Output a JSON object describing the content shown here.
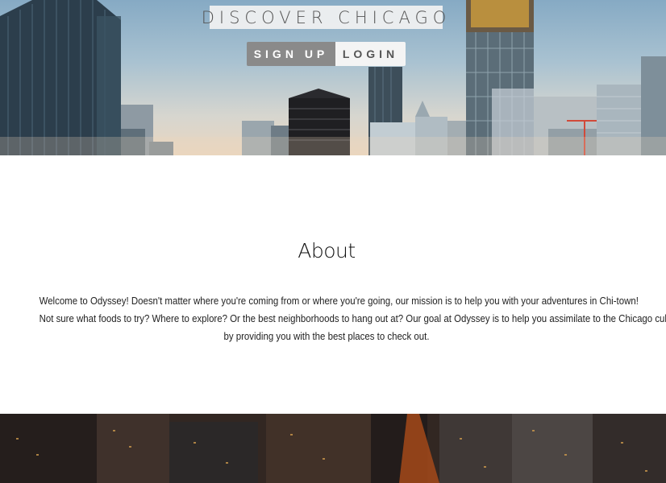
{
  "hero": {
    "title": "DISCOVER CHICAGO",
    "signup_label": "SIGN UP",
    "login_label": "LOGIN"
  },
  "about": {
    "heading": "About",
    "line1": "Welcome to Odyssey! Doesn't matter where you're coming from or where you're going, our mission is to help you with your adventures in Chi-town!",
    "line2": "Not sure what foods to try? Where to explore? Or the best neighborhoods to hang out at? Our goal at Odyssey is to help you assimilate to the Chicago culture",
    "line3": "by providing you with the best places to check out."
  },
  "colors": {
    "signup_bg": "#8a8a8a",
    "login_bg": "#f4f4f4",
    "title_bg": "#f2f2f2"
  }
}
